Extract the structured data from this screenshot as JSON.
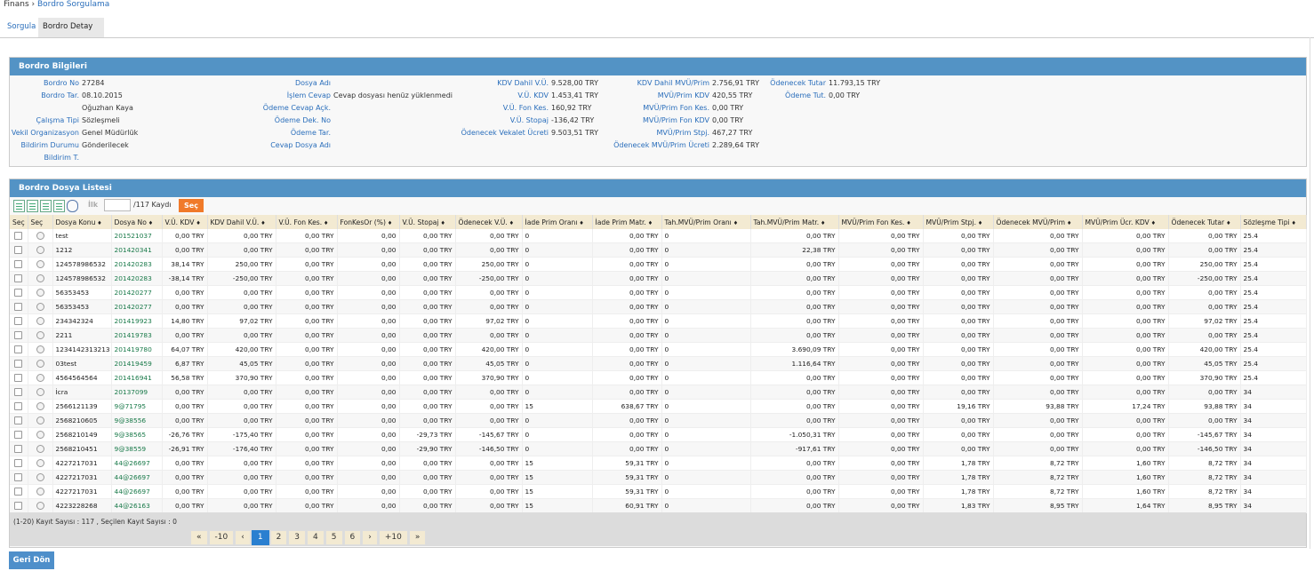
{
  "breadcrumb": {
    "root": "Finans",
    "separator": "›",
    "current": "Bordro Sorgulama"
  },
  "tabs": [
    "Sorgula",
    "Bordro Detay"
  ],
  "panel1": {
    "title": "Bordro Bilgileri",
    "col1": [
      {
        "label": "Bordro No",
        "value": "27284"
      },
      {
        "label": "Bordro Tar.",
        "value": "08.10.2015"
      },
      {
        "label": "",
        "value": "Oğuzhan Kaya"
      },
      {
        "label": "Çalışma Tipi",
        "value": "Sözleşmeli"
      },
      {
        "label": "Vekil Organizasyon",
        "value": "Genel Müdürlük"
      },
      {
        "label": "Bildirim Durumu",
        "value": "Gönderilecek"
      },
      {
        "label": "Bildirim T.",
        "value": ""
      }
    ],
    "col2": [
      {
        "label": "Dosya Adı",
        "value": ""
      },
      {
        "label": "İşlem Cevap",
        "value": "Cevap dosyası henüz yüklenmedi"
      },
      {
        "label": "Ödeme Cevap Açk.",
        "value": ""
      },
      {
        "label": "Ödeme Dek. No",
        "value": ""
      },
      {
        "label": "Ödeme Tar.",
        "value": ""
      },
      {
        "label": "Cevap Dosya Adı",
        "value": ""
      }
    ],
    "col3": [
      {
        "label": "KDV Dahil V.Ü.",
        "value": "9.528,00 TRY"
      },
      {
        "label": "V.Ü. KDV",
        "value": "1.453,41 TRY"
      },
      {
        "label": "V.Ü. Fon Kes.",
        "value": "160,92 TRY"
      },
      {
        "label": "V.Ü. Stopaj",
        "value": "-136,42 TRY"
      },
      {
        "label": "Ödenecek Vekalet Ücreti",
        "value": "9.503,51 TRY"
      }
    ],
    "col4": [
      {
        "label": "KDV Dahil MVÜ/Prim",
        "value": "2.756,91 TRY"
      },
      {
        "label": "MVÜ/Prim KDV",
        "value": "420,55 TRY"
      },
      {
        "label": "MVÜ/Prim Fon Kes.",
        "value": "0,00 TRY"
      },
      {
        "label": "MVÜ/Prim Fon KDV",
        "value": "0,00 TRY"
      },
      {
        "label": "MVÜ/Prim Stpj.",
        "value": "467,27 TRY"
      },
      {
        "label": "Ödenecek MVÜ/Prim Ücreti",
        "value": "2.289,64 TRY"
      }
    ],
    "col5": [
      {
        "label": "Ödenecek Tutar",
        "value": "11.793,15 TRY"
      },
      {
        "label": "Ödeme Tut.",
        "value": "0,00 TRY"
      }
    ]
  },
  "panel2": {
    "title": "Bordro Dosya Listesi",
    "toolbar": {
      "ilk": "İlk",
      "input_value": "",
      "kayit": "/117 Kaydı",
      "sec_button": "Seç"
    },
    "columns": [
      "Seç",
      "Seç",
      "Dosya Konu",
      "Dosya No",
      "V.Ü. KDV",
      "KDV Dahil V.Ü.",
      "V.Ü. Fon Kes.",
      "FonKesOr (%)",
      "V.Ü. Stopaj",
      "Ödenecek V.Ü.",
      "İade Prim Oranı",
      "İade Prim Matr.",
      "Tah.MVÜ/Prim Oranı",
      "Tah.MVÜ/Prim Matr.",
      "MVÜ/Prim Fon Kes.",
      "MVÜ/Prim Stpj.",
      "Ödenecek MVÜ/Prim",
      "MVÜ/Prim Ücr. KDV",
      "Ödenecek Tutar",
      "Sözleşme Tipi"
    ],
    "rows": [
      [
        "test",
        "201521037",
        "0,00 TRY",
        "0,00 TRY",
        "0,00 TRY",
        "0,00",
        "0,00 TRY",
        "0,00 TRY",
        "0",
        "0,00 TRY",
        "0",
        "0,00 TRY",
        "0,00 TRY",
        "0,00 TRY",
        "0,00 TRY",
        "0,00 TRY",
        "0,00 TRY",
        "25.4"
      ],
      [
        "1212",
        "201420341",
        "0,00 TRY",
        "0,00 TRY",
        "0,00 TRY",
        "0,00",
        "0,00 TRY",
        "0,00 TRY",
        "0",
        "0,00 TRY",
        "0",
        "22,38 TRY",
        "0,00 TRY",
        "0,00 TRY",
        "0,00 TRY",
        "0,00 TRY",
        "0,00 TRY",
        "25.4"
      ],
      [
        "124578986532",
        "201420283",
        "38,14 TRY",
        "250,00 TRY",
        "0,00 TRY",
        "0,00",
        "0,00 TRY",
        "250,00 TRY",
        "0",
        "0,00 TRY",
        "0",
        "0,00 TRY",
        "0,00 TRY",
        "0,00 TRY",
        "0,00 TRY",
        "0,00 TRY",
        "250,00 TRY",
        "25.4"
      ],
      [
        "124578986532",
        "201420283",
        "-38,14 TRY",
        "-250,00 TRY",
        "0,00 TRY",
        "0,00",
        "0,00 TRY",
        "-250,00 TRY",
        "0",
        "0,00 TRY",
        "0",
        "0,00 TRY",
        "0,00 TRY",
        "0,00 TRY",
        "0,00 TRY",
        "0,00 TRY",
        "-250,00 TRY",
        "25.4"
      ],
      [
        "56353453",
        "201420277",
        "0,00 TRY",
        "0,00 TRY",
        "0,00 TRY",
        "0,00",
        "0,00 TRY",
        "0,00 TRY",
        "0",
        "0,00 TRY",
        "0",
        "0,00 TRY",
        "0,00 TRY",
        "0,00 TRY",
        "0,00 TRY",
        "0,00 TRY",
        "0,00 TRY",
        "25.4"
      ],
      [
        "56353453",
        "201420277",
        "0,00 TRY",
        "0,00 TRY",
        "0,00 TRY",
        "0,00",
        "0,00 TRY",
        "0,00 TRY",
        "0",
        "0,00 TRY",
        "0",
        "0,00 TRY",
        "0,00 TRY",
        "0,00 TRY",
        "0,00 TRY",
        "0,00 TRY",
        "0,00 TRY",
        "25.4"
      ],
      [
        "234342324",
        "201419923",
        "14,80 TRY",
        "97,02 TRY",
        "0,00 TRY",
        "0,00",
        "0,00 TRY",
        "97,02 TRY",
        "0",
        "0,00 TRY",
        "0",
        "0,00 TRY",
        "0,00 TRY",
        "0,00 TRY",
        "0,00 TRY",
        "0,00 TRY",
        "97,02 TRY",
        "25.4"
      ],
      [
        "2211",
        "201419783",
        "0,00 TRY",
        "0,00 TRY",
        "0,00 TRY",
        "0,00",
        "0,00 TRY",
        "0,00 TRY",
        "0",
        "0,00 TRY",
        "0",
        "0,00 TRY",
        "0,00 TRY",
        "0,00 TRY",
        "0,00 TRY",
        "0,00 TRY",
        "0,00 TRY",
        "25.4"
      ],
      [
        "1234142313213",
        "201419780",
        "64,07 TRY",
        "420,00 TRY",
        "0,00 TRY",
        "0,00",
        "0,00 TRY",
        "420,00 TRY",
        "0",
        "0,00 TRY",
        "0",
        "3.690,09 TRY",
        "0,00 TRY",
        "0,00 TRY",
        "0,00 TRY",
        "0,00 TRY",
        "420,00 TRY",
        "25.4"
      ],
      [
        "03test",
        "201419459",
        "6,87 TRY",
        "45,05 TRY",
        "0,00 TRY",
        "0,00",
        "0,00 TRY",
        "45,05 TRY",
        "0",
        "0,00 TRY",
        "0",
        "1.116,64 TRY",
        "0,00 TRY",
        "0,00 TRY",
        "0,00 TRY",
        "0,00 TRY",
        "45,05 TRY",
        "25.4"
      ],
      [
        "4564564564",
        "201416941",
        "56,58 TRY",
        "370,90 TRY",
        "0,00 TRY",
        "0,00",
        "0,00 TRY",
        "370,90 TRY",
        "0",
        "0,00 TRY",
        "0",
        "0,00 TRY",
        "0,00 TRY",
        "0,00 TRY",
        "0,00 TRY",
        "0,00 TRY",
        "370,90 TRY",
        "25.4"
      ],
      [
        "İcra",
        "20137099",
        "0,00 TRY",
        "0,00 TRY",
        "0,00 TRY",
        "0,00",
        "0,00 TRY",
        "0,00 TRY",
        "0",
        "0,00 TRY",
        "0",
        "0,00 TRY",
        "0,00 TRY",
        "0,00 TRY",
        "0,00 TRY",
        "0,00 TRY",
        "0,00 TRY",
        "34"
      ],
      [
        "2566121139",
        "9@71795",
        "0,00 TRY",
        "0,00 TRY",
        "0,00 TRY",
        "0,00",
        "0,00 TRY",
        "0,00 TRY",
        "15",
        "638,67 TRY",
        "0",
        "0,00 TRY",
        "0,00 TRY",
        "19,16 TRY",
        "93,88 TRY",
        "17,24 TRY",
        "93,88 TRY",
        "34"
      ],
      [
        "2568210605",
        "9@38556",
        "0,00 TRY",
        "0,00 TRY",
        "0,00 TRY",
        "0,00",
        "0,00 TRY",
        "0,00 TRY",
        "0",
        "0,00 TRY",
        "0",
        "0,00 TRY",
        "0,00 TRY",
        "0,00 TRY",
        "0,00 TRY",
        "0,00 TRY",
        "0,00 TRY",
        "34"
      ],
      [
        "2568210149",
        "9@38565",
        "-26,76 TRY",
        "-175,40 TRY",
        "0,00 TRY",
        "0,00",
        "-29,73 TRY",
        "-145,67 TRY",
        "0",
        "0,00 TRY",
        "0",
        "-1.050,31 TRY",
        "0,00 TRY",
        "0,00 TRY",
        "0,00 TRY",
        "0,00 TRY",
        "-145,67 TRY",
        "34"
      ],
      [
        "2568210451",
        "9@38559",
        "-26,91 TRY",
        "-176,40 TRY",
        "0,00 TRY",
        "0,00",
        "-29,90 TRY",
        "-146,50 TRY",
        "0",
        "0,00 TRY",
        "0",
        "-917,61 TRY",
        "0,00 TRY",
        "0,00 TRY",
        "0,00 TRY",
        "0,00 TRY",
        "-146,50 TRY",
        "34"
      ],
      [
        "4227217031",
        "44@26697",
        "0,00 TRY",
        "0,00 TRY",
        "0,00 TRY",
        "0,00",
        "0,00 TRY",
        "0,00 TRY",
        "15",
        "59,31 TRY",
        "0",
        "0,00 TRY",
        "0,00 TRY",
        "1,78 TRY",
        "8,72 TRY",
        "1,60 TRY",
        "8,72 TRY",
        "34"
      ],
      [
        "4227217031",
        "44@26697",
        "0,00 TRY",
        "0,00 TRY",
        "0,00 TRY",
        "0,00",
        "0,00 TRY",
        "0,00 TRY",
        "15",
        "59,31 TRY",
        "0",
        "0,00 TRY",
        "0,00 TRY",
        "1,78 TRY",
        "8,72 TRY",
        "1,60 TRY",
        "8,72 TRY",
        "34"
      ],
      [
        "4227217031",
        "44@26697",
        "0,00 TRY",
        "0,00 TRY",
        "0,00 TRY",
        "0,00",
        "0,00 TRY",
        "0,00 TRY",
        "15",
        "59,31 TRY",
        "0",
        "0,00 TRY",
        "0,00 TRY",
        "1,78 TRY",
        "8,72 TRY",
        "1,60 TRY",
        "8,72 TRY",
        "34"
      ],
      [
        "4223228268",
        "44@26163",
        "0,00 TRY",
        "0,00 TRY",
        "0,00 TRY",
        "0,00",
        "0,00 TRY",
        "0,00 TRY",
        "15",
        "60,91 TRY",
        "0",
        "0,00 TRY",
        "0,00 TRY",
        "1,83 TRY",
        "8,95 TRY",
        "1,64 TRY",
        "8,95 TRY",
        "34"
      ]
    ],
    "kayit_info": "(1-20) Kayıt Sayısı : 117 , Seçilen Kayıt Sayısı : 0",
    "pager": [
      "«",
      "-10",
      "‹",
      "1",
      "2",
      "3",
      "4",
      "5",
      "6",
      "›",
      "+10",
      "»"
    ],
    "pager_active": "1"
  },
  "back_button": "Geri Dön",
  "colors": {
    "panel_header": "#5393c5",
    "sec_button": "#f07a2a",
    "link": "#1a7a4a",
    "pager_active": "#2a7fd0"
  }
}
